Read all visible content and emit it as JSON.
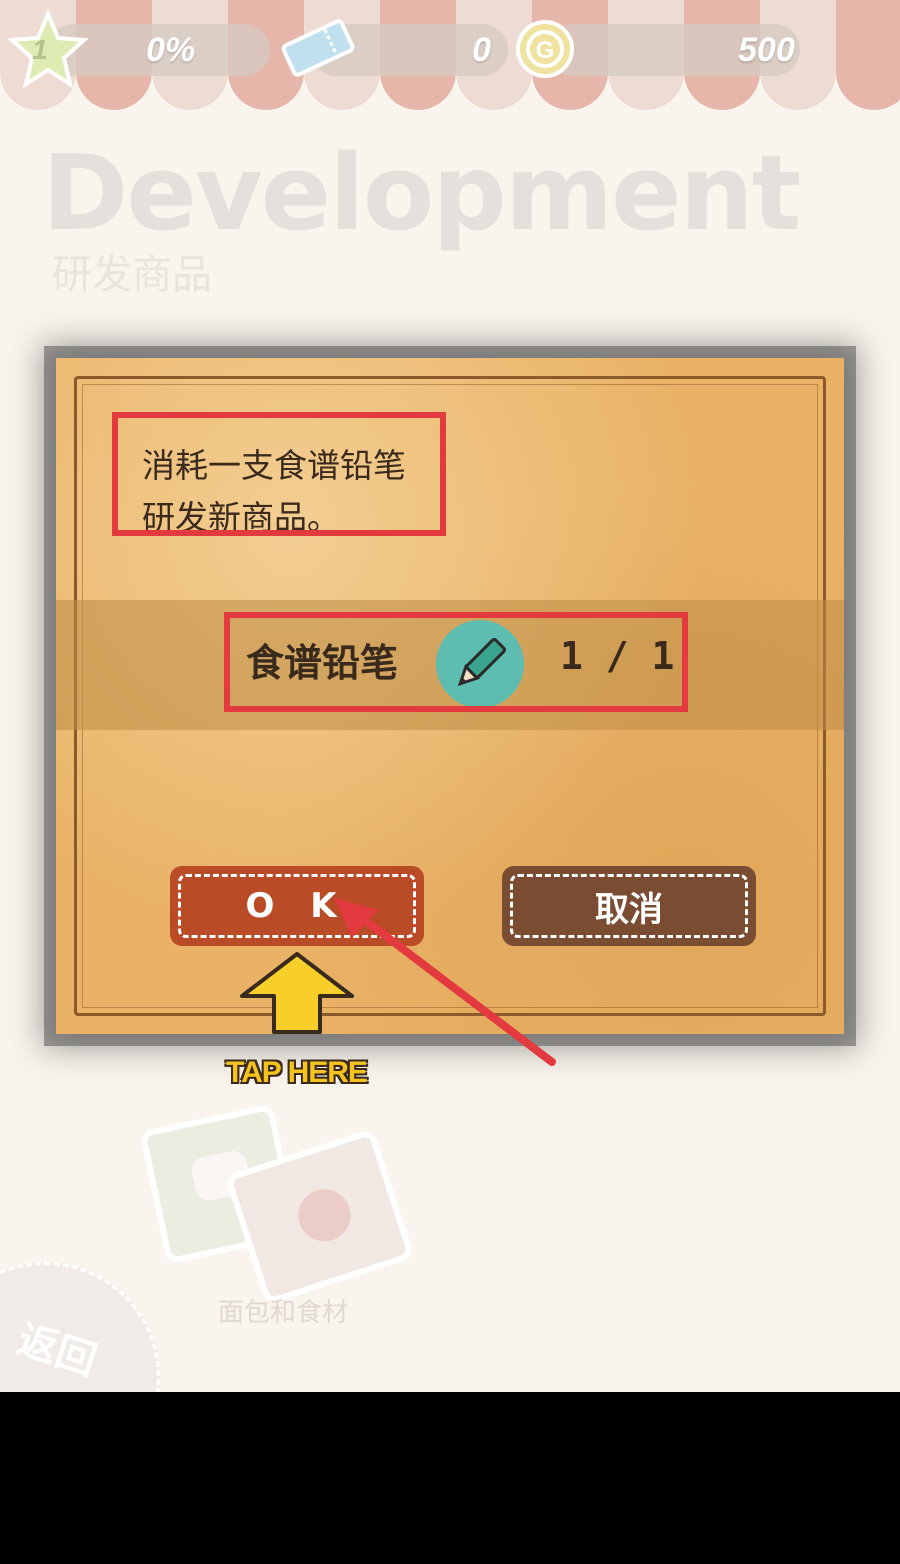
{
  "hud": {
    "level": "1",
    "progress": "0%",
    "tickets": "0",
    "coins": "500"
  },
  "page": {
    "title_en": "Development",
    "title_cn": "研发商品"
  },
  "dialog": {
    "message_line1": "消耗一支食谱铅笔",
    "message_line2": "研发新商品。",
    "resource_label": "食谱铅笔",
    "resource_count": "1 / 1",
    "ok_label": "O K",
    "cancel_label": "取消"
  },
  "hint": {
    "tap_text": "TAP HERE"
  },
  "category": {
    "label": "面包和食材"
  },
  "nav": {
    "back_label": "返回"
  },
  "colors": {
    "highlight": "#e23a3f",
    "ok_button": "#b94b27",
    "cancel_button": "#7a4d32",
    "dialog_bg": "#e9b266"
  }
}
